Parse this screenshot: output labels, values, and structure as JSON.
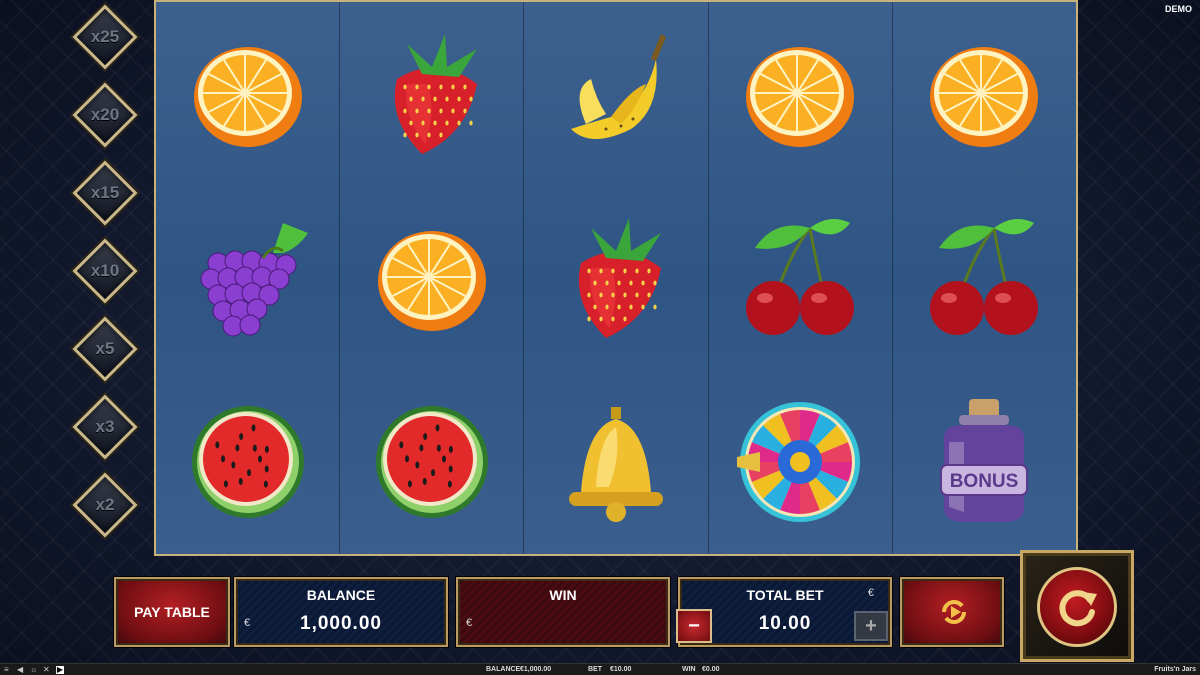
{
  "header": {
    "mode_badge": "DEMO"
  },
  "multipliers": [
    "x25",
    "x20",
    "x15",
    "x10",
    "x5",
    "x3",
    "x2"
  ],
  "reels": [
    [
      "orange",
      "grapes",
      "watermelon"
    ],
    [
      "strawberry",
      "orange",
      "watermelon"
    ],
    [
      "banana",
      "strawberry",
      "bell"
    ],
    [
      "orange",
      "cherries",
      "wheel"
    ],
    [
      "orange",
      "cherries",
      "bonus-jar"
    ]
  ],
  "symbol_text": {
    "bonus_jar_label": "BONUS"
  },
  "panel": {
    "paytable_label": "PAY TABLE",
    "balance_label": "BALANCE",
    "balance_currency": "€",
    "balance_value": "1,000.00",
    "win_label": "WIN",
    "win_currency": "€",
    "win_value": "",
    "total_bet_label": "TOTAL BET",
    "bet_currency": "€",
    "bet_value": "10.00",
    "minus_label": "−",
    "plus_label": "+"
  },
  "statusbar": {
    "balance_label": "BALANCE",
    "balance_value": "€1,000.00",
    "bet_label": "BET",
    "bet_value": "€10.00",
    "win_label": "WIN",
    "win_value": "€0.00",
    "game_name": "Fruits'n Jars"
  },
  "colors": {
    "gold": "#c7b27a",
    "reel_blue": "#33598a",
    "button_red": "#b31f24"
  }
}
